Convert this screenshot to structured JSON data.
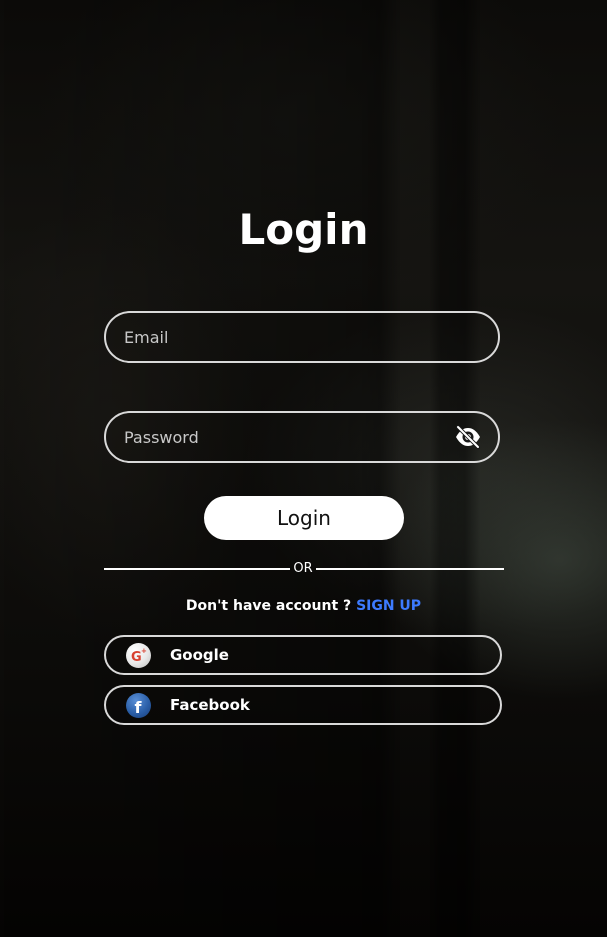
{
  "page": {
    "title": "Login"
  },
  "form": {
    "email_placeholder": "Email",
    "email_value": "",
    "password_placeholder": "Password",
    "password_value": "",
    "login_label": "Login"
  },
  "divider": {
    "text": "OR"
  },
  "signup": {
    "prompt": "Don't have account ?",
    "link_label": "SIGN UP",
    "link_color": "#3d7bff"
  },
  "social": {
    "google_label": "Google",
    "facebook_label": "Facebook"
  },
  "icons": {
    "eye": "eye-slash-icon",
    "google": "google-plus-icon",
    "facebook": "facebook-icon"
  }
}
